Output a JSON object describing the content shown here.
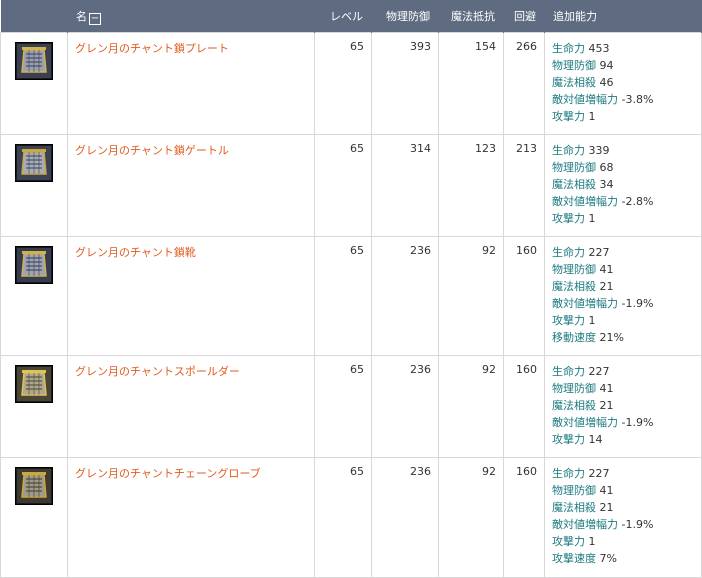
{
  "headers": {
    "name": "名",
    "collapse": "−",
    "level": "レベル",
    "phys_def": "物理防御",
    "mag_res": "魔法抵抗",
    "evasion": "回避",
    "bonus": "追加能力"
  },
  "items": [
    {
      "icon": "chain-plate-armor-icon",
      "name": "グレン月のチャント鎖プレート",
      "level": "65",
      "phys_def": "393",
      "mag_res": "154",
      "evasion": "266",
      "bonus": [
        {
          "stat": "生命力",
          "value": "453"
        },
        {
          "stat": "物理防御",
          "value": "94"
        },
        {
          "stat": "魔法相殺",
          "value": "46"
        },
        {
          "stat": "敵対値増幅力",
          "value": "-3.8%"
        },
        {
          "stat": "攻撃力",
          "value": "1"
        }
      ]
    },
    {
      "icon": "chain-greaves-icon",
      "name": "グレン月のチャント鎖ゲートル",
      "level": "65",
      "phys_def": "314",
      "mag_res": "123",
      "evasion": "213",
      "bonus": [
        {
          "stat": "生命力",
          "value": "339"
        },
        {
          "stat": "物理防御",
          "value": "68"
        },
        {
          "stat": "魔法相殺",
          "value": "34"
        },
        {
          "stat": "敵対値増幅力",
          "value": "-2.8%"
        },
        {
          "stat": "攻撃力",
          "value": "1"
        }
      ]
    },
    {
      "icon": "chain-boots-icon",
      "name": "グレン月のチャント鎖靴",
      "level": "65",
      "phys_def": "236",
      "mag_res": "92",
      "evasion": "160",
      "bonus": [
        {
          "stat": "生命力",
          "value": "227"
        },
        {
          "stat": "物理防御",
          "value": "41"
        },
        {
          "stat": "魔法相殺",
          "value": "21"
        },
        {
          "stat": "敵対値増幅力",
          "value": "-1.9%"
        },
        {
          "stat": "攻撃力",
          "value": "1"
        },
        {
          "stat": "移動速度",
          "value": "21%"
        }
      ]
    },
    {
      "icon": "chain-shoulder-icon",
      "name": "グレン月のチャントスポールダー",
      "level": "65",
      "phys_def": "236",
      "mag_res": "92",
      "evasion": "160",
      "bonus": [
        {
          "stat": "生命力",
          "value": "227"
        },
        {
          "stat": "物理防御",
          "value": "41"
        },
        {
          "stat": "魔法相殺",
          "value": "21"
        },
        {
          "stat": "敵対値増幅力",
          "value": "-1.9%"
        },
        {
          "stat": "攻撃力",
          "value": "14"
        }
      ]
    },
    {
      "icon": "chain-gloves-icon",
      "name": "グレン月のチャントチェーングローブ",
      "level": "65",
      "phys_def": "236",
      "mag_res": "92",
      "evasion": "160",
      "bonus": [
        {
          "stat": "生命力",
          "value": "227"
        },
        {
          "stat": "物理防御",
          "value": "41"
        },
        {
          "stat": "魔法相殺",
          "value": "21"
        },
        {
          "stat": "敵対値増幅力",
          "value": "-1.9%"
        },
        {
          "stat": "攻撃力",
          "value": "1"
        },
        {
          "stat": "攻撃速度",
          "value": "7%"
        }
      ]
    }
  ]
}
